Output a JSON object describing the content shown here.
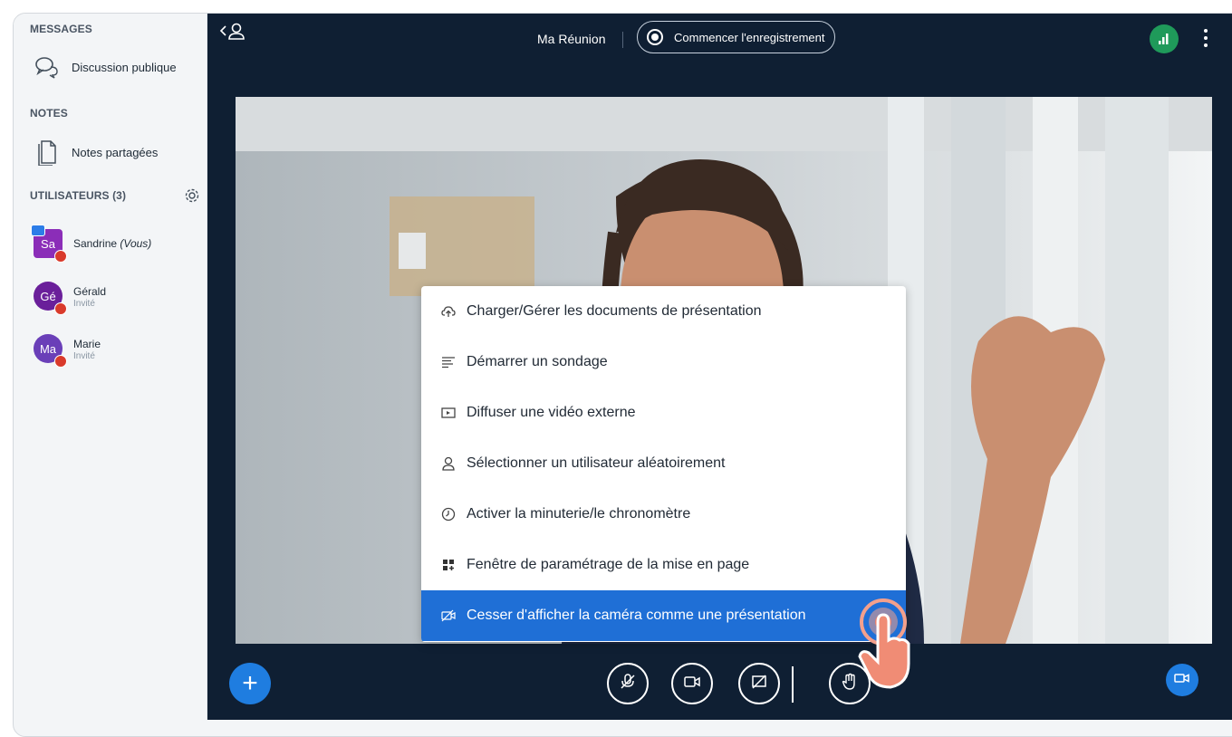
{
  "sidebar": {
    "messages_title": "MESSAGES",
    "public_chat_label": "Discussion publique",
    "notes_title": "NOTES",
    "shared_notes_label": "Notes partagées",
    "users_title": "UTILISATEURS (3)",
    "users": [
      {
        "initials": "Sa",
        "name": "Sandrine",
        "suffix": "(Vous)",
        "role": "",
        "color": "#8b2db8"
      },
      {
        "initials": "Gé",
        "name": "Gérald",
        "suffix": "",
        "role": "Invité",
        "color": "#6a1f9a"
      },
      {
        "initials": "Ma",
        "name": "Marie",
        "suffix": "",
        "role": "Invité",
        "color": "#6a3fb8"
      }
    ]
  },
  "topbar": {
    "meeting_name": "Ma Réunion",
    "record_label": "Commencer l'enregistrement"
  },
  "actions_menu": {
    "items": [
      {
        "label": "Charger/Gérer les documents de présentation",
        "icon": "cloud-upload-icon"
      },
      {
        "label": "Démarrer un sondage",
        "icon": "poll-list-icon"
      },
      {
        "label": "Diffuser une vidéo externe",
        "icon": "external-video-icon"
      },
      {
        "label": "Sélectionner un utilisateur aléatoirement",
        "icon": "user-icon"
      },
      {
        "label": "Activer la minuterie/le chronomètre",
        "icon": "timer-icon"
      },
      {
        "label": "Fenêtre de paramétrage de la mise en page",
        "icon": "layout-grid-icon"
      },
      {
        "label": "Cesser d'afficher la caméra comme une présentation",
        "icon": "camera-off-icon"
      }
    ],
    "active_index": 6
  },
  "colors": {
    "accent": "#1f7de0",
    "topbar_bg": "#0f1f33",
    "menu_active_bg": "#1f6fd6",
    "connection_good": "#1f9a5a",
    "muted_badge": "#d93a2b"
  }
}
